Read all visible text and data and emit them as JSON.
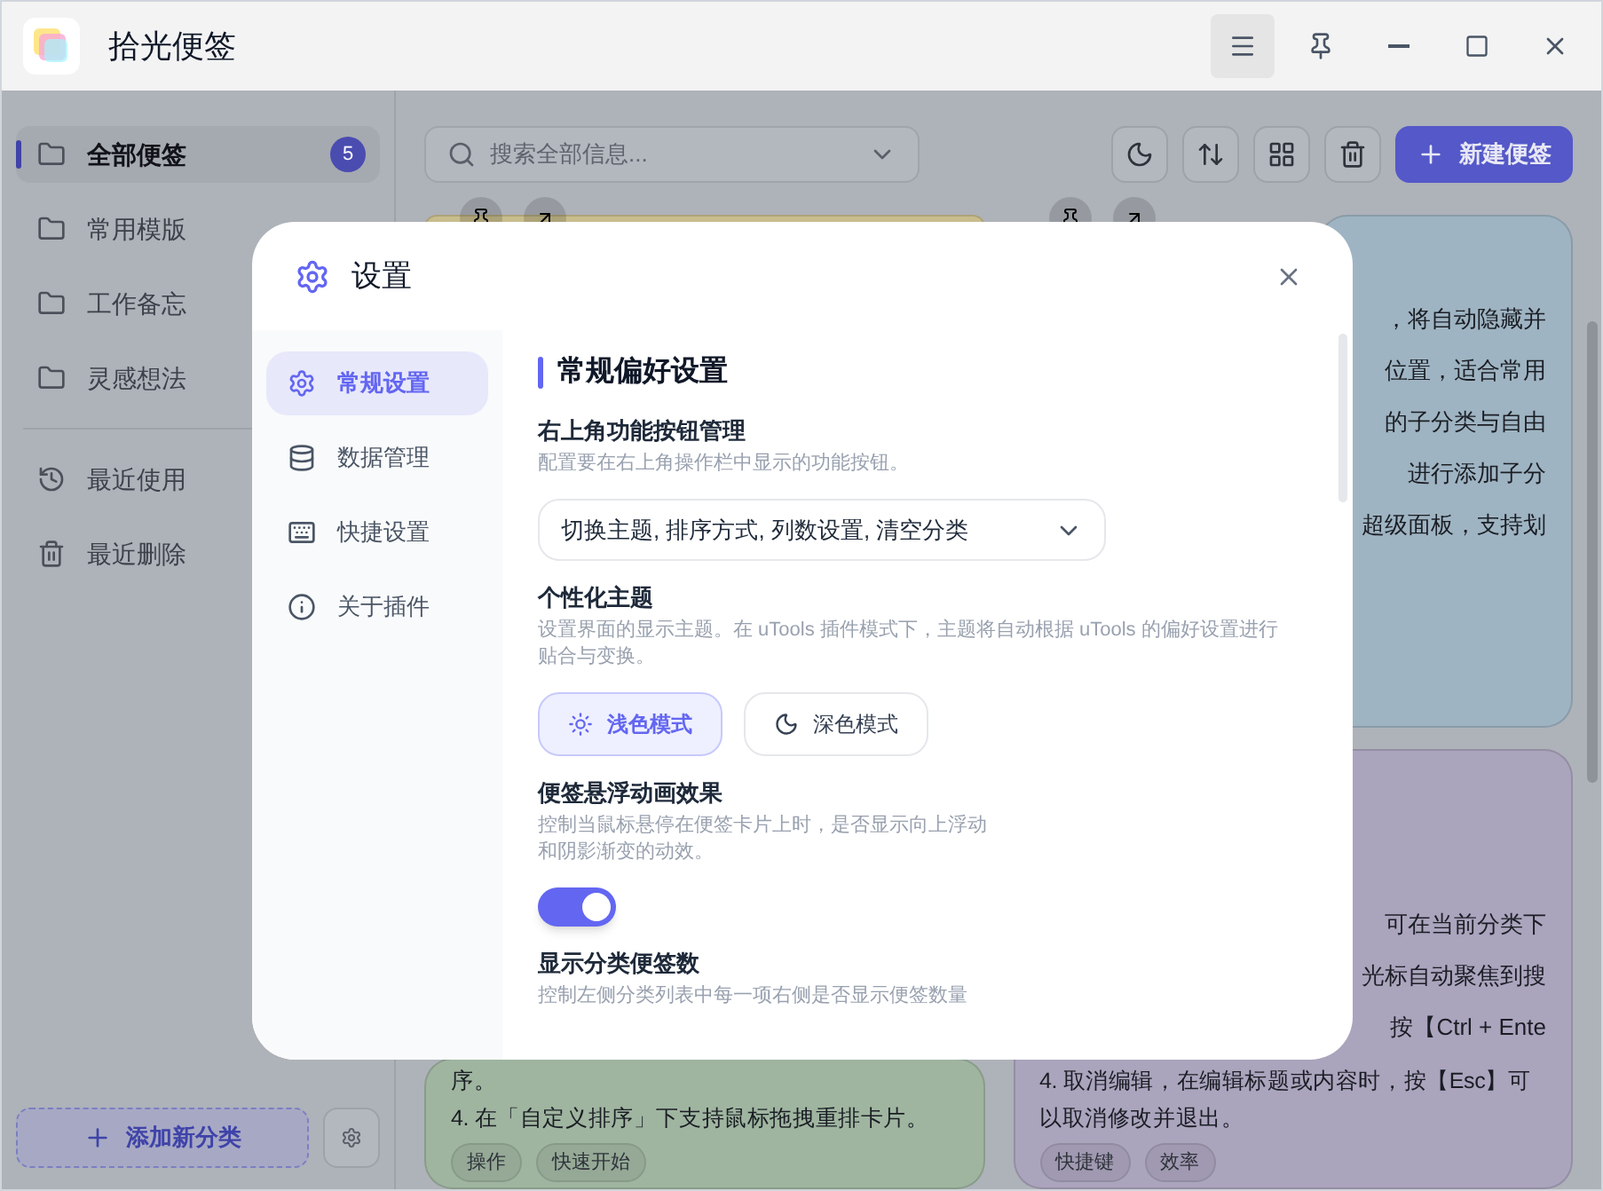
{
  "window": {
    "title": "拾光便签"
  },
  "sidebar": {
    "categories": [
      {
        "label": "全部便签",
        "count": "5",
        "selected": true
      },
      {
        "label": "常用模版",
        "selected": false
      },
      {
        "label": "工作备忘",
        "selected": false
      },
      {
        "label": "灵感想法",
        "selected": false
      }
    ],
    "views": [
      {
        "label": "最近使用",
        "kind": "recent"
      },
      {
        "label": "最近删除",
        "kind": "trash"
      }
    ],
    "add_button": "添加新分类"
  },
  "search": {
    "placeholder": "搜索全部信息..."
  },
  "new_button": "新建便签",
  "columns": [
    [
      {
        "color": "#c8bd8c"
      },
      {
        "color": "#9fb5a0",
        "lines": [
          "序。",
          "4. 在「自定义排序」下支持鼠标拖拽重排卡片。"
        ],
        "tags": [
          "操作",
          "快速开始"
        ]
      }
    ],
    [
      {
        "color": "#9fb4c2",
        "fragments": [
          "，将自动隐藏并",
          "位置，适合常用",
          "的子分类与自由",
          "进行添加子分",
          "超级面板，支持划"
        ]
      },
      {
        "color": "#aba4bd",
        "fragments": [
          "可在当前分类下",
          "光标自动聚焦到搜",
          "按【Ctrl + Ente"
        ],
        "lines": [
          "4. 取消编辑，在编辑标题或内容时，按【Esc】可以取消修改并退出。"
        ],
        "tags": [
          "快捷键",
          "效率"
        ]
      }
    ]
  ],
  "settings_dialog": {
    "title": "设置",
    "nav": [
      {
        "label": "常规设置",
        "kind": "general",
        "selected": true
      },
      {
        "label": "数据管理",
        "kind": "data",
        "selected": false
      },
      {
        "label": "快捷设置",
        "kind": "shortcut",
        "selected": false
      },
      {
        "label": "关于插件",
        "kind": "about",
        "selected": false
      }
    ],
    "section_title": "常规偏好设置",
    "settings": [
      {
        "kind": "select",
        "title": "右上角功能按钮管理",
        "description": "配置要在右上角操作栏中显示的功能按钮。",
        "value": "切换主题, 排序方式, 列数设置, 清空分类"
      },
      {
        "kind": "theme",
        "title": "个性化主题",
        "description": "设置界面的显示主题。在 uTools 插件模式下，主题将自动根据 uTools 的偏好设置进行贴合与变换。",
        "options": [
          {
            "label": "浅色模式",
            "kind": "light",
            "selected": true
          },
          {
            "label": "深色模式",
            "kind": "dark",
            "selected": false
          }
        ]
      },
      {
        "kind": "toggle",
        "title": "便签悬浮动画效果",
        "description": "控制当鼠标悬停在便签卡片上时，是否显示向上浮动和阴影渐变的动效。",
        "on": true
      },
      {
        "kind": "text",
        "title": "显示分类便签数",
        "description": "控制左侧分类列表中每一项右侧是否显示便签数量"
      }
    ]
  }
}
